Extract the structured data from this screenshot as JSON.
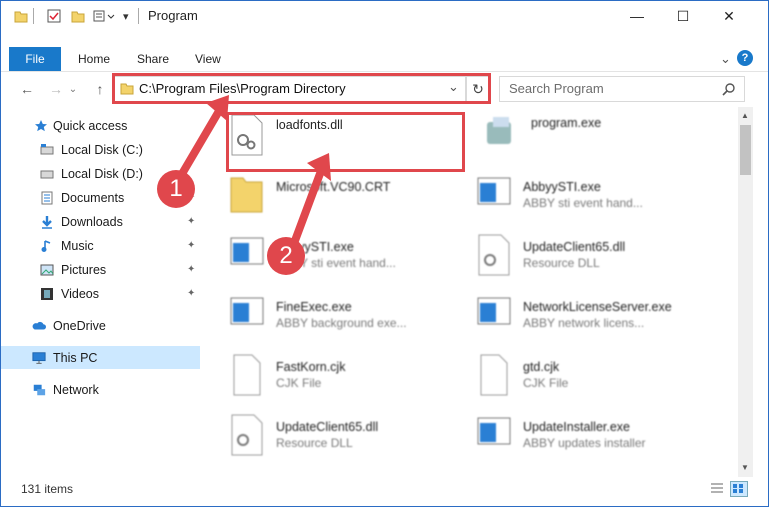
{
  "window": {
    "title": "Program"
  },
  "titlebar": {
    "minimize": "—",
    "maximize": "☐",
    "close": "✕"
  },
  "ribbon": {
    "file": "File",
    "tabs": [
      "Home",
      "Share",
      "View"
    ],
    "expand": "⌄",
    "help": "?"
  },
  "nav": {
    "back": "←",
    "forward": "→",
    "up": "↑",
    "recent": "⌄"
  },
  "address": {
    "path": "C:\\Program Files\\Program Directory",
    "dropdown": "⌄",
    "refresh": "↻"
  },
  "search": {
    "placeholder": "Search Program"
  },
  "sidebar": {
    "items": [
      {
        "label": "Quick access"
      },
      {
        "label": "Local Disk (C:)"
      },
      {
        "label": "Local Disk (D:)"
      },
      {
        "label": "Documents"
      },
      {
        "label": "Downloads"
      },
      {
        "label": "Music"
      },
      {
        "label": "Pictures"
      },
      {
        "label": "Videos"
      },
      {
        "label": "OneDrive"
      },
      {
        "label": "This PC"
      },
      {
        "label": "Network"
      }
    ],
    "pin_glyph": "📌"
  },
  "files": [
    {
      "name": "loadfonts.dll",
      "desc": ""
    },
    {
      "name": "program.exe",
      "desc": ""
    },
    {
      "name": "Microsoft.VC90.CRT",
      "desc": ""
    },
    {
      "name": "AbbyySTI.exe",
      "desc": "ABBY sti event hand..."
    },
    {
      "name": "AbbyySTI.exe",
      "desc": "ABBY sti event hand..."
    },
    {
      "name": "UpdateClient65.dll",
      "desc": "Resource DLL"
    },
    {
      "name": "FineExec.exe",
      "desc": "ABBY background exe..."
    },
    {
      "name": "NetworkLicenseServer.exe",
      "desc": "ABBY network licens..."
    },
    {
      "name": "FastKorn.cjk",
      "desc": "CJK File"
    },
    {
      "name": "gtd.cjk",
      "desc": "CJK File"
    },
    {
      "name": "UpdateClient65.dll",
      "desc": "Resource DLL"
    },
    {
      "name": "UpdateInstaller.exe",
      "desc": "ABBY updates installer"
    }
  ],
  "status": {
    "count": "131 items"
  },
  "annotations": {
    "badge1": "1",
    "badge2": "2",
    "color": "#e0474c"
  },
  "colors": {
    "accent": "#1979ca",
    "selected": "#cce8ff"
  }
}
